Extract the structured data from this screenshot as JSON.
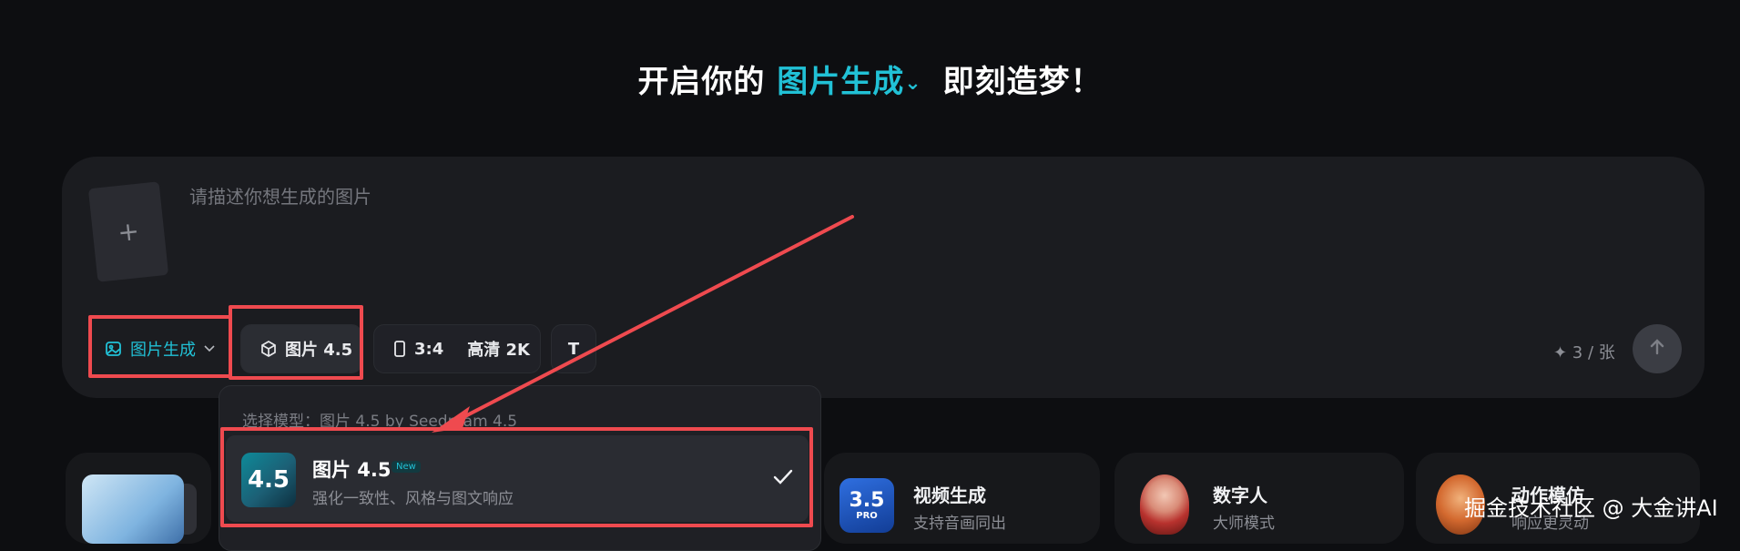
{
  "header": {
    "prefix": "开启你的",
    "mode": "图片生成",
    "suffix": "即刻造梦！"
  },
  "composer": {
    "placeholder": "请描述你想生成的图片",
    "mode_chip": "图片生成",
    "model_chip": "图片 4.5",
    "ratio_chip": "3:4",
    "quality_chip": "高清 2K",
    "text_chip": "T",
    "credits": "✦ 3 / 张"
  },
  "dropdown": {
    "header": "选择模型：图片 4.5 by Seedream 4.5",
    "item": {
      "thumb": "4.5",
      "title": "图片 4.5",
      "badge": "New",
      "desc": "强化一致性、风格与图文响应"
    }
  },
  "features": [
    {
      "thumb": "3.5",
      "thumb_sub": "PRO",
      "title": "视频生成",
      "sub": "支持音画同出"
    },
    {
      "title": "数字人",
      "sub": "大师模式"
    },
    {
      "title": "动作模仿",
      "sub": "响应更灵动"
    }
  ],
  "watermark": "掘金技术社区 @ 大金讲AI",
  "colors": {
    "accent": "#21c1d6",
    "annotation_red": "#ef4a4f",
    "background": "#0d0e11",
    "panel": "#1b1c20"
  }
}
